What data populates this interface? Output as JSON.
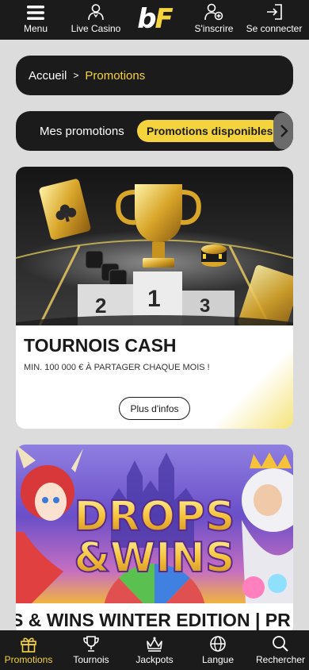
{
  "topbar": {
    "menu_label": "Menu",
    "live_casino_label": "Live Casino",
    "logo_b": "b",
    "logo_f": "F",
    "signup_label": "S'inscrire",
    "login_label": "Se connecter"
  },
  "breadcrumb": {
    "home": "Accueil",
    "separator": ">",
    "current": "Promotions"
  },
  "tabs": {
    "mine": "Mes promotions",
    "available": "Promotions disponibles"
  },
  "promos": [
    {
      "title": "TOURNOIS CASH",
      "subtitle": "MIN. 100 000 € À PARTAGER CHAQUE MOIS !",
      "button": "Plus d'infos",
      "podium": [
        "2",
        "1",
        "3"
      ]
    },
    {
      "banner_line1": "DROPS",
      "banner_line2": "&WINS",
      "title": "S & WINS WINTER EDITION | PR"
    }
  ],
  "bottomnav": {
    "promotions": "Promotions",
    "tournois": "Tournois",
    "jackpots": "Jackpots",
    "langue": "Langue",
    "rechercher": "Rechercher"
  },
  "colors": {
    "accent": "#f5d33d",
    "bar": "#1b1b1b",
    "page_bg": "#dcdcdc"
  }
}
